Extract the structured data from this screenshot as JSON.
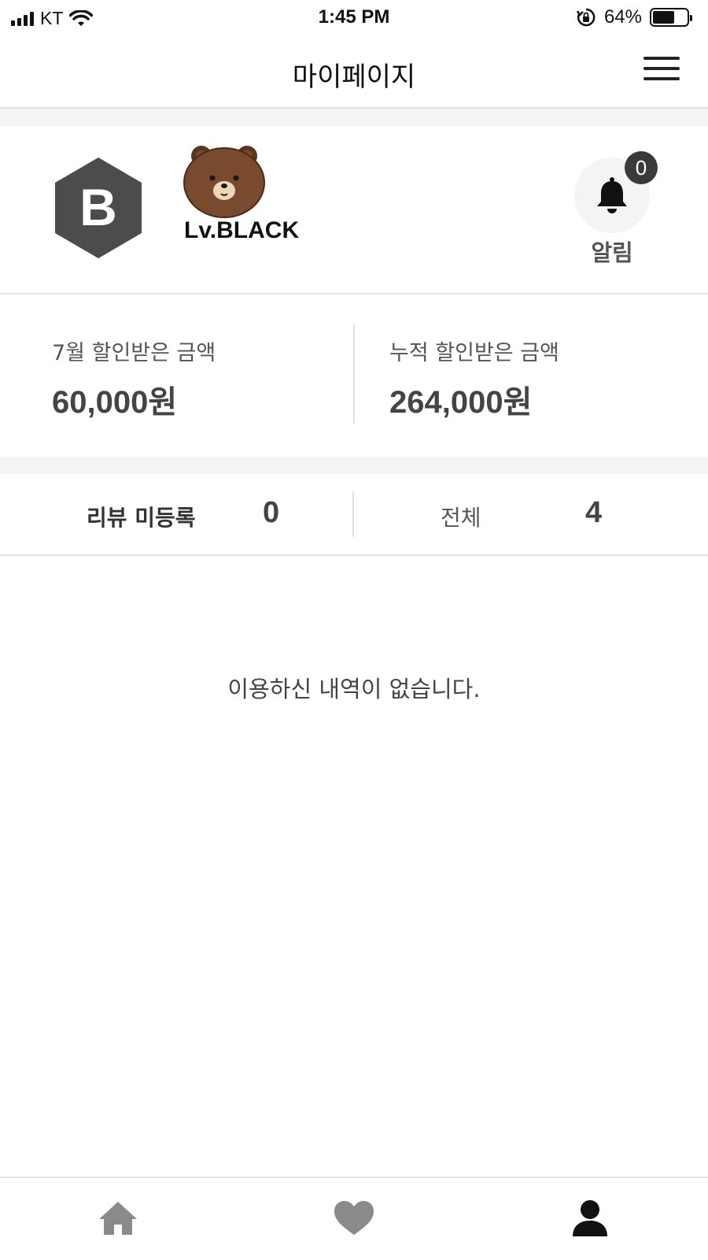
{
  "status_bar": {
    "carrier": "KT",
    "time": "1:45 PM",
    "battery_percent": "64%",
    "battery_level": 0.64,
    "icons": [
      "signal-icon",
      "wifi-icon",
      "rotation-lock-icon",
      "battery-icon"
    ]
  },
  "header": {
    "title": "마이페이지",
    "menu_icon": "hamburger-menu-icon"
  },
  "profile": {
    "grade_letter": "B",
    "avatar_icon": "bear-avatar-icon",
    "level": "Lv.BLACK",
    "notification": {
      "count": "0",
      "label": "알림",
      "icon": "bell-icon"
    }
  },
  "stats": {
    "monthly": {
      "label": "7월 할인받은 금액",
      "value": "60,000원"
    },
    "total": {
      "label": "누적 할인받은 금액",
      "value": "264,000원"
    }
  },
  "tabs": [
    {
      "label": "리뷰 미등록",
      "count": "0",
      "active": true
    },
    {
      "label": "전체",
      "count": "4",
      "active": false
    }
  ],
  "empty_message": "이용하신 내역이 없습니다.",
  "bottom_nav": [
    {
      "name": "home",
      "icon": "home-icon",
      "active": false
    },
    {
      "name": "favorites",
      "icon": "heart-icon",
      "active": false
    },
    {
      "name": "mypage",
      "icon": "person-icon",
      "active": true
    }
  ],
  "colors": {
    "badge_gray": "#4d4c4c",
    "text_dark": "#111111",
    "nav_inactive": "#8a8a8a",
    "nav_active": "#111111",
    "bear_brown": "#7a4a2e"
  }
}
